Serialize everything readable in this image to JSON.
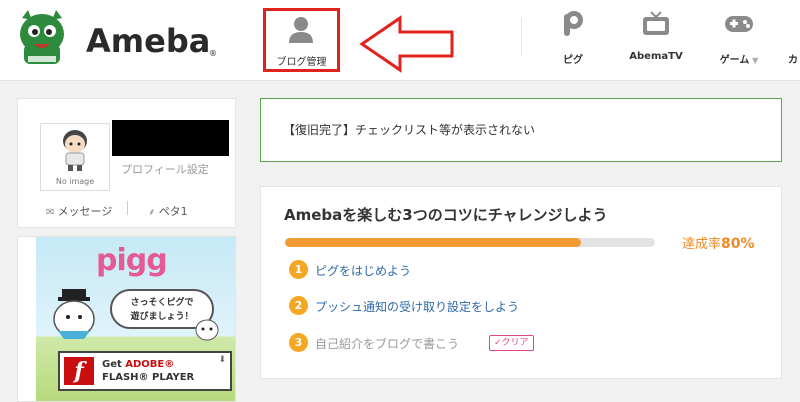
{
  "header": {
    "logo_text": "Ameba",
    "logo_mark": "®",
    "blog_management_label": "ブログ管理",
    "nav": [
      {
        "label": "ピグ",
        "icon": "pigg-icon"
      },
      {
        "label": "AbemaTV",
        "icon": "tv-icon"
      },
      {
        "label": "ゲーム",
        "icon": "gamepad-icon",
        "has_dropdown": true
      },
      {
        "label": "カ",
        "icon": "more-icon"
      }
    ],
    "highlight_color": "#e0231c"
  },
  "sidebar": {
    "avatar_label": "No image",
    "profile_settings": "プロフィール設定",
    "message_link": "メッセージ",
    "peta_link": "ペタ1",
    "ad": {
      "pigg_logo": "pigg",
      "bubble_line1": "さっそくピグで",
      "bubble_line2": "遊びましょう！",
      "flash_line1_prefix": "Get ",
      "flash_line1_brand": "ADOBE®",
      "flash_line2": "FLASH® PLAYER"
    }
  },
  "notice": {
    "text": "【復旧完了】チェックリスト等が表示されない",
    "border_color": "#5aa84c"
  },
  "challenge": {
    "title": "Amebaを楽しむ3つのコツにチャレンジしよう",
    "progress_label": "達成率",
    "progress_value": "80%",
    "progress_fraction": 0.8,
    "steps": [
      {
        "num": "1",
        "label": "ピグをはじめよう",
        "done": false
      },
      {
        "num": "2",
        "label": "プッシュ通知の受け取り設定をしよう",
        "done": false
      },
      {
        "num": "3",
        "label": "自己紹介をブログで書こう",
        "done": true,
        "badge": "✓クリア"
      }
    ],
    "accent_color": "#f39a32"
  }
}
